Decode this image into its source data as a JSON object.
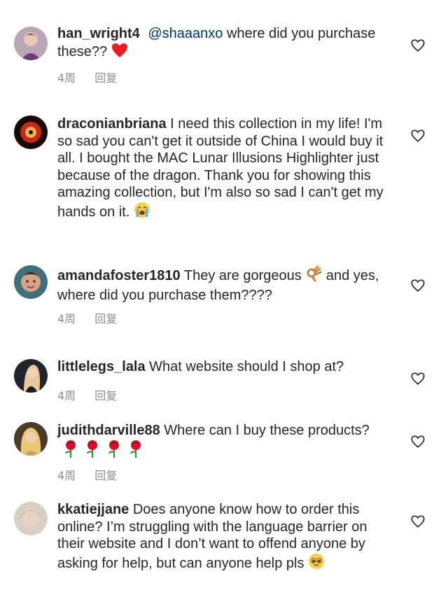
{
  "comments": [
    {
      "username": "han_wright4",
      "mention": "@shaaanxo",
      "text": " where did you purchase these??",
      "emoji": "heart",
      "meta": {
        "time": "4周",
        "reply": "回复"
      }
    },
    {
      "username": "draconianbriana",
      "text": " I need this collection in my life! I'm so sad you can't get it outside of China I would buy it all. I bought the MAC Lunar Illusions Highlighter just because of the dragon. Thank you for showing this amazing collection, but I'm also so sad I can't get my hands on it.",
      "emoji": "crying-face"
    },
    {
      "username": "amandafoster1810",
      "text_a": " They are gorgeous",
      "text_b": " and yes, where did you purchase them????",
      "emoji": "ok-hand",
      "meta": {
        "time": "4周",
        "reply": "回复"
      }
    },
    {
      "username": "littlelegs_lala",
      "text": " What website should I shop at?",
      "meta": {
        "time": "4周",
        "reply": "回复"
      }
    },
    {
      "username": "judithdarville88",
      "text": " Where can I buy these products?",
      "emoji": "rose",
      "meta": {
        "time": "4周",
        "reply": "回复"
      }
    },
    {
      "username": "kkatiejjane",
      "text": " Does anyone know how to order this online? I’m struggling with the language barrier on their website and I don’t want to offend anyone by asking for help, but can anyone help pls",
      "emoji": "pleading-face"
    }
  ],
  "colors": {
    "text": "#262626",
    "meta": "#8e8e8e",
    "mention": "#00376b",
    "heart": "#ed1c24",
    "rose": "#d0132a"
  }
}
